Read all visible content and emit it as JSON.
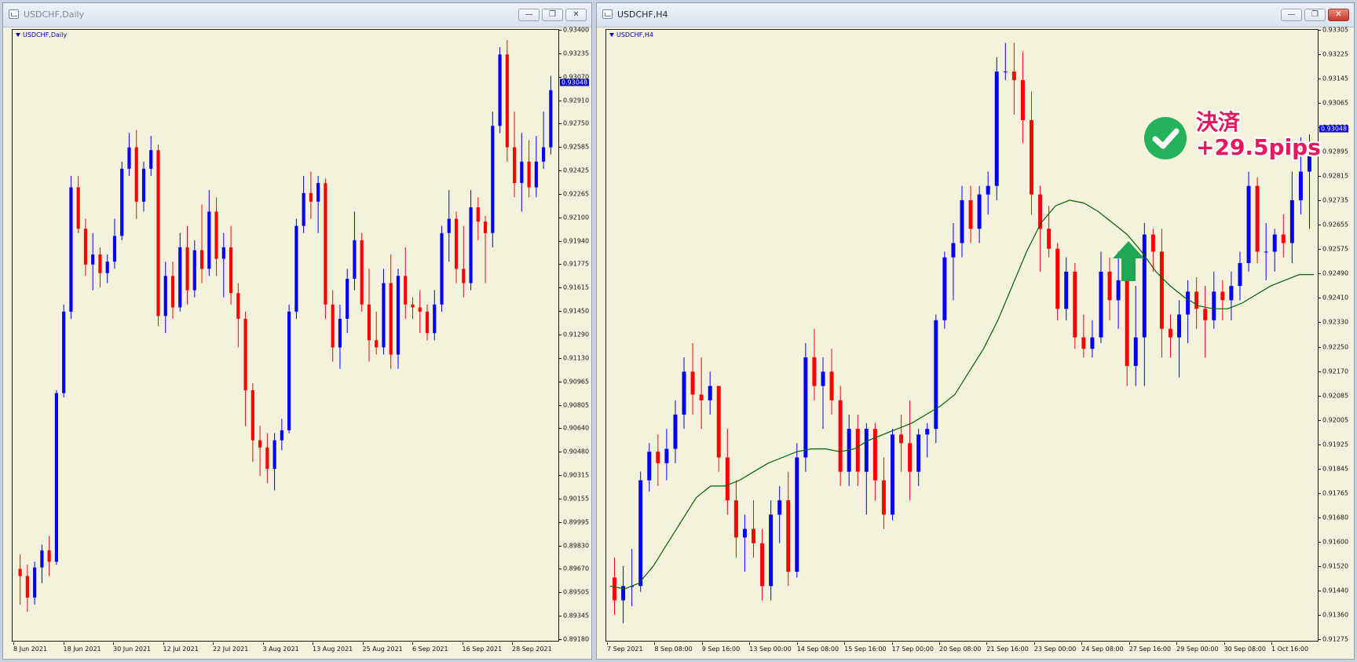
{
  "windows": {
    "left": {
      "title": "USDCHF,Daily",
      "symbol_label": "USDCHF,Daily"
    },
    "right": {
      "title": "USDCHF,H4",
      "symbol_label": "USDCHF,H4"
    }
  },
  "window_buttons": {
    "minimize": "—",
    "restore": "❐",
    "close": "✕"
  },
  "colors": {
    "bull": "#0000ff",
    "bear": "#ff0000",
    "wick_bull": "#0000ff",
    "wick_bear": "#ff0000",
    "ma": "#006400",
    "background": "#f4f2dc",
    "price_tag": "#0000cc",
    "note": "#e8175d",
    "badge": "#24b35a"
  },
  "annotation": {
    "line1": "決済",
    "line2": "+29.5pips",
    "badge_icon": "check-icon",
    "arrow_icon": "arrow-up-icon"
  },
  "chart_data": [
    {
      "type": "candlestick",
      "title": "USDCHF,Daily",
      "current_price": "0.93048",
      "ylim": [
        0.8918,
        0.934
      ],
      "y_ticks": [
        "0.93400",
        "0.93235",
        "0.93070",
        "0.92910",
        "0.92750",
        "0.92585",
        "0.92425",
        "0.92265",
        "0.92100",
        "0.91940",
        "0.91775",
        "0.91615",
        "0.91450",
        "0.91290",
        "0.91130",
        "0.90965",
        "0.90805",
        "0.90640",
        "0.90480",
        "0.90315",
        "0.90155",
        "0.89995",
        "0.89830",
        "0.89670",
        "0.89505",
        "0.89345",
        "0.89180"
      ],
      "x_ticks": [
        "8 Jun 2021",
        "18 Jun 2021",
        "30 Jun 2021",
        "12 Jul 2021",
        "22 Jul 2021",
        "3 Aug 2021",
        "13 Aug 2021",
        "25 Aug 2021",
        "6 Sep 2021",
        "16 Sep 2021",
        "28 Sep 2021"
      ],
      "candles": [
        [
          0.8965,
          0.8975,
          0.894,
          0.896
        ],
        [
          0.896,
          0.8968,
          0.8935,
          0.8945
        ],
        [
          0.8945,
          0.897,
          0.894,
          0.8966
        ],
        [
          0.8966,
          0.8982,
          0.8955,
          0.8978
        ],
        [
          0.8978,
          0.8988,
          0.896,
          0.897
        ],
        [
          0.897,
          0.909,
          0.8968,
          0.9088
        ],
        [
          0.9088,
          0.915,
          0.9085,
          0.9145
        ],
        [
          0.9145,
          0.924,
          0.914,
          0.9232
        ],
        [
          0.9232,
          0.924,
          0.92,
          0.9203
        ],
        [
          0.9203,
          0.921,
          0.917,
          0.9178
        ],
        [
          0.9178,
          0.92,
          0.916,
          0.9185
        ],
        [
          0.9185,
          0.919,
          0.9162,
          0.9172
        ],
        [
          0.9172,
          0.9185,
          0.9165,
          0.918
        ],
        [
          0.918,
          0.921,
          0.9175,
          0.9198
        ],
        [
          0.9198,
          0.925,
          0.9195,
          0.9245
        ],
        [
          0.9245,
          0.927,
          0.924,
          0.926
        ],
        [
          0.926,
          0.9272,
          0.921,
          0.9222
        ],
        [
          0.9222,
          0.925,
          0.9215,
          0.9245
        ],
        [
          0.9245,
          0.9268,
          0.924,
          0.9258
        ],
        [
          0.9258,
          0.9262,
          0.9135,
          0.9142
        ],
        [
          0.9142,
          0.918,
          0.913,
          0.917
        ],
        [
          0.917,
          0.918,
          0.914,
          0.9148
        ],
        [
          0.9148,
          0.92,
          0.9145,
          0.919
        ],
        [
          0.919,
          0.9205,
          0.915,
          0.916
        ],
        [
          0.916,
          0.9195,
          0.9155,
          0.9188
        ],
        [
          0.9188,
          0.922,
          0.9165,
          0.9175
        ],
        [
          0.9175,
          0.923,
          0.917,
          0.9215
        ],
        [
          0.9215,
          0.9225,
          0.917,
          0.9182
        ],
        [
          0.9182,
          0.92,
          0.9155,
          0.919
        ],
        [
          0.919,
          0.9205,
          0.915,
          0.9158
        ],
        [
          0.9158,
          0.9165,
          0.912,
          0.914
        ],
        [
          0.914,
          0.9145,
          0.9065,
          0.909
        ],
        [
          0.909,
          0.9095,
          0.904,
          0.9055
        ],
        [
          0.9055,
          0.9065,
          0.903,
          0.905
        ],
        [
          0.905,
          0.906,
          0.9025,
          0.9035
        ],
        [
          0.9035,
          0.906,
          0.902,
          0.9055
        ],
        [
          0.9055,
          0.907,
          0.9048,
          0.9062
        ],
        [
          0.9062,
          0.915,
          0.906,
          0.9145
        ],
        [
          0.9145,
          0.921,
          0.914,
          0.9205
        ],
        [
          0.9205,
          0.924,
          0.92,
          0.9228
        ],
        [
          0.9228,
          0.9243,
          0.921,
          0.9222
        ],
        [
          0.9222,
          0.924,
          0.92,
          0.9235
        ],
        [
          0.9235,
          0.9238,
          0.914,
          0.915
        ],
        [
          0.915,
          0.916,
          0.911,
          0.912
        ],
        [
          0.912,
          0.915,
          0.9105,
          0.914
        ],
        [
          0.914,
          0.9175,
          0.913,
          0.9168
        ],
        [
          0.9168,
          0.9215,
          0.916,
          0.9195
        ],
        [
          0.9195,
          0.92,
          0.9145,
          0.915
        ],
        [
          0.915,
          0.9175,
          0.911,
          0.9125
        ],
        [
          0.9125,
          0.9145,
          0.9115,
          0.912
        ],
        [
          0.912,
          0.9175,
          0.9115,
          0.9165
        ],
        [
          0.9165,
          0.9185,
          0.9105,
          0.9115
        ],
        [
          0.9115,
          0.9175,
          0.9105,
          0.917
        ],
        [
          0.917,
          0.919,
          0.914,
          0.915
        ],
        [
          0.915,
          0.9155,
          0.914,
          0.9148
        ],
        [
          0.9148,
          0.916,
          0.913,
          0.9145
        ],
        [
          0.9145,
          0.915,
          0.9125,
          0.913
        ],
        [
          0.913,
          0.916,
          0.9125,
          0.915
        ],
        [
          0.915,
          0.9205,
          0.9145,
          0.92
        ],
        [
          0.92,
          0.923,
          0.918,
          0.921
        ],
        [
          0.921,
          0.9215,
          0.9165,
          0.9175
        ],
        [
          0.9175,
          0.9205,
          0.9155,
          0.9165
        ],
        [
          0.9165,
          0.923,
          0.916,
          0.9218
        ],
        [
          0.9218,
          0.9225,
          0.9195,
          0.9208
        ],
        [
          0.9208,
          0.9212,
          0.9165,
          0.92
        ],
        [
          0.92,
          0.9285,
          0.919,
          0.9275
        ],
        [
          0.9275,
          0.933,
          0.927,
          0.9325
        ],
        [
          0.9325,
          0.9335,
          0.925,
          0.926
        ],
        [
          0.926,
          0.9285,
          0.9225,
          0.9235
        ],
        [
          0.9235,
          0.927,
          0.9215,
          0.925
        ],
        [
          0.925,
          0.9265,
          0.9225,
          0.9232
        ],
        [
          0.9232,
          0.9268,
          0.9225,
          0.925
        ],
        [
          0.925,
          0.9285,
          0.9245,
          0.926
        ],
        [
          0.926,
          0.931,
          0.9255,
          0.93
        ]
      ]
    },
    {
      "type": "candlestick",
      "title": "USDCHF,H4",
      "current_price": "0.93048",
      "indicator": "moving-average",
      "ylim": [
        0.91275,
        0.93385
      ],
      "y_ticks": [
        "0.93305",
        "0.93225",
        "0.93145",
        "0.93065",
        "0.92980",
        "0.92895",
        "0.92815",
        "0.92735",
        "0.92655",
        "0.92575",
        "0.92490",
        "0.92410",
        "0.92330",
        "0.92250",
        "0.92170",
        "0.92085",
        "0.92005",
        "0.91925",
        "0.91845",
        "0.91765",
        "0.91680",
        "0.91600",
        "0.91520",
        "0.91440",
        "0.91360",
        "0.91275"
      ],
      "x_ticks": [
        "7 Sep 2021",
        "8 Sep 08:00",
        "9 Sep 16:00",
        "13 Sep 00:00",
        "14 Sep 08:00",
        "15 Sep 16:00",
        "17 Sep 00:00",
        "20 Sep 08:00",
        "21 Sep 16:00",
        "23 Sep 00:00",
        "24 Sep 08:00",
        "27 Sep 16:00",
        "29 Sep 00:00",
        "30 Sep 08:00",
        "1 Oct 16:00"
      ],
      "candles": [
        [
          0.9148,
          0.9155,
          0.9135,
          0.914
        ],
        [
          0.914,
          0.9152,
          0.9132,
          0.9145
        ],
        [
          0.9145,
          0.9158,
          0.9138,
          0.9145
        ],
        [
          0.9145,
          0.9185,
          0.9143,
          0.9182
        ],
        [
          0.9182,
          0.9195,
          0.9178,
          0.9192
        ],
        [
          0.9192,
          0.9198,
          0.918,
          0.9188
        ],
        [
          0.9188,
          0.92,
          0.9182,
          0.9193
        ],
        [
          0.9193,
          0.921,
          0.9188,
          0.9205
        ],
        [
          0.9205,
          0.9225,
          0.92,
          0.922
        ],
        [
          0.922,
          0.923,
          0.9205,
          0.9212
        ],
        [
          0.9212,
          0.9225,
          0.92,
          0.921
        ],
        [
          0.921,
          0.922,
          0.9205,
          0.9215
        ],
        [
          0.9215,
          0.9215,
          0.9185,
          0.919
        ],
        [
          0.919,
          0.92,
          0.917,
          0.9175
        ],
        [
          0.9175,
          0.9182,
          0.9155,
          0.9162
        ],
        [
          0.9162,
          0.917,
          0.915,
          0.9165
        ],
        [
          0.9165,
          0.9175,
          0.9155,
          0.916
        ],
        [
          0.916,
          0.9165,
          0.914,
          0.9145
        ],
        [
          0.9145,
          0.9175,
          0.914,
          0.917
        ],
        [
          0.917,
          0.918,
          0.916,
          0.9175
        ],
        [
          0.9175,
          0.9185,
          0.9145,
          0.915
        ],
        [
          0.915,
          0.9195,
          0.9148,
          0.919
        ],
        [
          0.919,
          0.923,
          0.9185,
          0.9225
        ],
        [
          0.9225,
          0.9235,
          0.921,
          0.9215
        ],
        [
          0.9215,
          0.9225,
          0.92,
          0.922
        ],
        [
          0.922,
          0.9228,
          0.9205,
          0.921
        ],
        [
          0.921,
          0.9215,
          0.918,
          0.9185
        ],
        [
          0.9185,
          0.9205,
          0.918,
          0.92
        ],
        [
          0.92,
          0.9205,
          0.918,
          0.9185
        ],
        [
          0.9185,
          0.9202,
          0.917,
          0.92
        ],
        [
          0.92,
          0.9202,
          0.9175,
          0.9182
        ],
        [
          0.9182,
          0.919,
          0.9165,
          0.917
        ],
        [
          0.917,
          0.92,
          0.9168,
          0.9198
        ],
        [
          0.9198,
          0.9205,
          0.9185,
          0.9195
        ],
        [
          0.9195,
          0.921,
          0.9175,
          0.9185
        ],
        [
          0.9185,
          0.92,
          0.918,
          0.9198
        ],
        [
          0.9198,
          0.9202,
          0.919,
          0.92
        ],
        [
          0.92,
          0.924,
          0.9195,
          0.9238
        ],
        [
          0.9238,
          0.9262,
          0.9235,
          0.926
        ],
        [
          0.926,
          0.9272,
          0.9245,
          0.9265
        ],
        [
          0.9265,
          0.9285,
          0.926,
          0.928
        ],
        [
          0.928,
          0.9285,
          0.9265,
          0.927
        ],
        [
          0.927,
          0.9285,
          0.9265,
          0.9282
        ],
        [
          0.9282,
          0.929,
          0.9275,
          0.9285
        ],
        [
          0.9285,
          0.933,
          0.928,
          0.9325
        ],
        [
          0.9325,
          0.9335,
          0.9322,
          0.9325
        ],
        [
          0.9325,
          0.9335,
          0.931,
          0.9322
        ],
        [
          0.9322,
          0.9332,
          0.93,
          0.9308
        ],
        [
          0.9308,
          0.9318,
          0.9275,
          0.9282
        ],
        [
          0.9282,
          0.9285,
          0.9255,
          0.927
        ],
        [
          0.927,
          0.9278,
          0.926,
          0.9263
        ],
        [
          0.9263,
          0.9265,
          0.9238,
          0.9242
        ],
        [
          0.9242,
          0.926,
          0.9238,
          0.9255
        ],
        [
          0.9255,
          0.9258,
          0.9228,
          0.9232
        ],
        [
          0.9232,
          0.924,
          0.9225,
          0.9228
        ],
        [
          0.9228,
          0.9238,
          0.9225,
          0.9232
        ],
        [
          0.9232,
          0.9262,
          0.923,
          0.9255
        ],
        [
          0.9255,
          0.926,
          0.9238,
          0.9245
        ],
        [
          0.9245,
          0.9262,
          0.9235,
          0.9252
        ],
        [
          0.9252,
          0.9255,
          0.9215,
          0.9222
        ],
        [
          0.9222,
          0.925,
          0.9215,
          0.9232
        ],
        [
          0.9232,
          0.9272,
          0.9215,
          0.9268
        ],
        [
          0.9268,
          0.927,
          0.9255,
          0.9262
        ],
        [
          0.9262,
          0.927,
          0.9225,
          0.9235
        ],
        [
          0.9235,
          0.924,
          0.9225,
          0.9232
        ],
        [
          0.9232,
          0.9245,
          0.9218,
          0.924
        ],
        [
          0.924,
          0.9252,
          0.923,
          0.9248
        ],
        [
          0.9248,
          0.9253,
          0.9235,
          0.9242
        ],
        [
          0.9242,
          0.925,
          0.9225,
          0.9238
        ],
        [
          0.9238,
          0.9255,
          0.9235,
          0.9248
        ],
        [
          0.9248,
          0.9252,
          0.9238,
          0.9245
        ],
        [
          0.9245,
          0.9255,
          0.9238,
          0.925
        ],
        [
          0.925,
          0.9262,
          0.9245,
          0.9258
        ],
        [
          0.9258,
          0.929,
          0.9255,
          0.9285
        ],
        [
          0.9285,
          0.9288,
          0.9258,
          0.9262
        ],
        [
          0.9262,
          0.9272,
          0.9252,
          0.9262
        ],
        [
          0.9262,
          0.927,
          0.9255,
          0.9268
        ],
        [
          0.9268,
          0.9275,
          0.926,
          0.9265
        ],
        [
          0.9265,
          0.929,
          0.9258,
          0.928
        ],
        [
          0.928,
          0.9302,
          0.9275,
          0.929
        ],
        [
          0.929,
          0.9303,
          0.927,
          0.9298
        ]
      ],
      "ma": [
        0.9145,
        0.9144,
        0.9146,
        0.9152,
        0.916,
        0.9168,
        0.9176,
        0.918,
        0.918,
        0.9182,
        0.9185,
        0.9188,
        0.919,
        0.9192,
        0.9193,
        0.9193,
        0.9192,
        0.9193,
        0.9196,
        0.9198,
        0.92,
        0.9202,
        0.9205,
        0.9208,
        0.9212,
        0.922,
        0.9228,
        0.9238,
        0.925,
        0.9262,
        0.9272,
        0.9278,
        0.928,
        0.9279,
        0.9276,
        0.9272,
        0.9268,
        0.9262,
        0.9255,
        0.925,
        0.9246,
        0.9243,
        0.9242,
        0.9242,
        0.9244,
        0.9247,
        0.925,
        0.9252,
        0.9254,
        0.9254
      ]
    }
  ]
}
